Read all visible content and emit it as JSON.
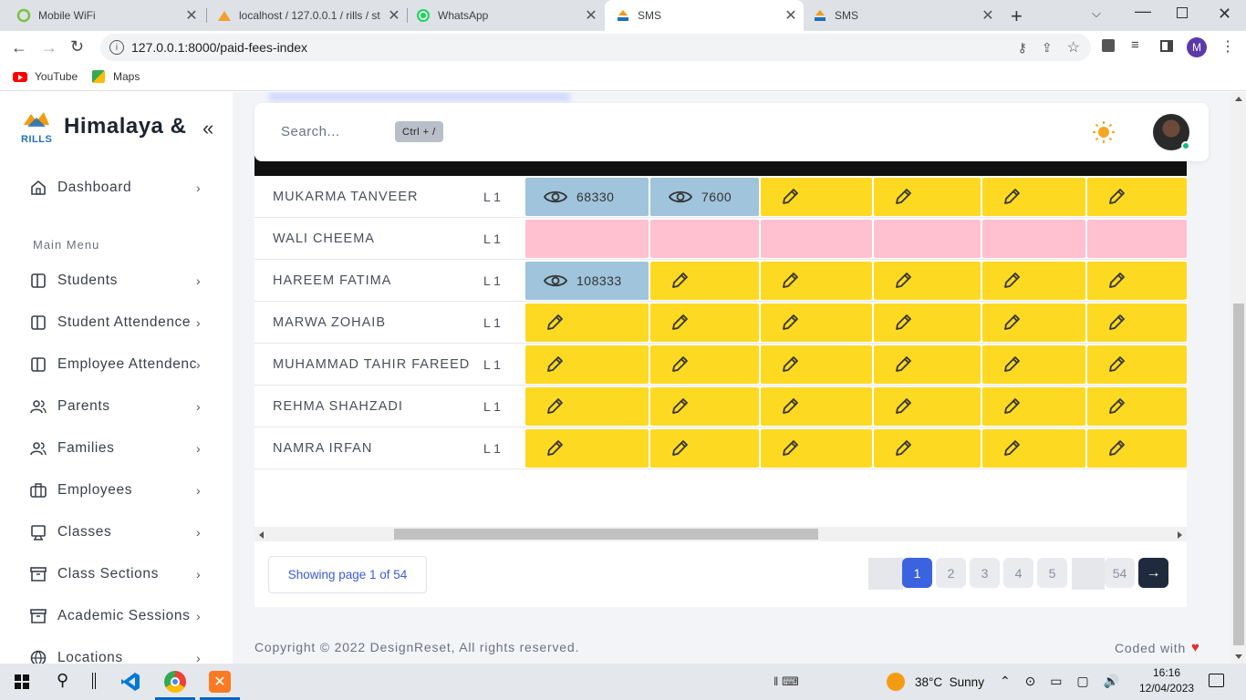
{
  "browser": {
    "tabs": [
      {
        "title": "Mobile WiFi",
        "active": false
      },
      {
        "title": "localhost / 127.0.0.1 / rills / st",
        "active": false
      },
      {
        "title": "WhatsApp",
        "active": false
      },
      {
        "title": "SMS",
        "active": true
      },
      {
        "title": "SMS",
        "active": false
      }
    ],
    "url": "127.0.0.1:8000/paid-fees-index",
    "bookmarks": [
      {
        "label": "YouTube",
        "icon": "youtube-icon"
      },
      {
        "label": "Maps",
        "icon": "maps-icon"
      }
    ],
    "profile_initial": "M"
  },
  "sidebar": {
    "logo_text": "RILLS",
    "brand": "Himalaya &",
    "dashboard": "Dashboard",
    "section_title": "Main Menu",
    "items": [
      {
        "label": "Students",
        "icon": "columns-icon"
      },
      {
        "label": "Student Attendence",
        "icon": "columns-icon"
      },
      {
        "label": "Employee Attendence",
        "icon": "columns-icon"
      },
      {
        "label": "Parents",
        "icon": "users-icon"
      },
      {
        "label": "Families",
        "icon": "users-icon"
      },
      {
        "label": "Employees",
        "icon": "briefcase-icon"
      },
      {
        "label": "Classes",
        "icon": "monitor-icon"
      },
      {
        "label": "Class Sections",
        "icon": "archive-icon"
      },
      {
        "label": "Academic Sessions",
        "icon": "archive-icon"
      },
      {
        "label": "Locations",
        "icon": "globe-icon"
      }
    ]
  },
  "topbar": {
    "search_placeholder": "Search...",
    "shortcut": "Ctrl + /"
  },
  "table": {
    "rows": [
      {
        "name": "MUKARMA TANVEER",
        "level": "L 1",
        "cells": [
          {
            "status": "paid",
            "value": "68330"
          },
          {
            "status": "paid",
            "value": "7600"
          },
          {
            "status": "due"
          },
          {
            "status": "due"
          },
          {
            "status": "due"
          },
          {
            "status": "due"
          }
        ]
      },
      {
        "name": "WALI CHEEMA",
        "level": "L 1",
        "cells": [
          {
            "status": "na"
          },
          {
            "status": "na"
          },
          {
            "status": "na"
          },
          {
            "status": "na"
          },
          {
            "status": "na"
          },
          {
            "status": "na"
          }
        ]
      },
      {
        "name": "HAREEM FATIMA",
        "level": "L 1",
        "cells": [
          {
            "status": "paid",
            "value": "108333"
          },
          {
            "status": "due"
          },
          {
            "status": "due"
          },
          {
            "status": "due"
          },
          {
            "status": "due"
          },
          {
            "status": "due"
          }
        ]
      },
      {
        "name": "MARWA ZOHAIB",
        "level": "L 1",
        "cells": [
          {
            "status": "due"
          },
          {
            "status": "due"
          },
          {
            "status": "due"
          },
          {
            "status": "due"
          },
          {
            "status": "due"
          },
          {
            "status": "due"
          }
        ]
      },
      {
        "name": "MUHAMMAD TAHIR FAREED",
        "level": "L 1",
        "cells": [
          {
            "status": "due"
          },
          {
            "status": "due"
          },
          {
            "status": "due"
          },
          {
            "status": "due"
          },
          {
            "status": "due"
          },
          {
            "status": "due"
          }
        ]
      },
      {
        "name": "REHMA SHAHZADI",
        "level": "L 1",
        "cells": [
          {
            "status": "due"
          },
          {
            "status": "due"
          },
          {
            "status": "due"
          },
          {
            "status": "due"
          },
          {
            "status": "due"
          },
          {
            "status": "due"
          }
        ]
      },
      {
        "name": "NAMRA IRFAN",
        "level": "L 1",
        "cells": [
          {
            "status": "due"
          },
          {
            "status": "due"
          },
          {
            "status": "due"
          },
          {
            "status": "due"
          },
          {
            "status": "due"
          },
          {
            "status": "due"
          }
        ]
      }
    ],
    "colors": {
      "due": "#fdd922",
      "paid": "#9fc4dc",
      "na": "#ffc0cf"
    }
  },
  "pagination": {
    "summary": "Showing page 1 of 54",
    "pages": [
      "1",
      "2",
      "3",
      "4",
      "5",
      "54"
    ],
    "current": "1"
  },
  "footer": {
    "copyright": "Copyright © 2022 DesignReset, All rights reserved.",
    "coded_with": "Coded with"
  },
  "taskbar": {
    "weather": "38°C  Sunny",
    "time": "16:16",
    "date": "12/04/2023"
  }
}
